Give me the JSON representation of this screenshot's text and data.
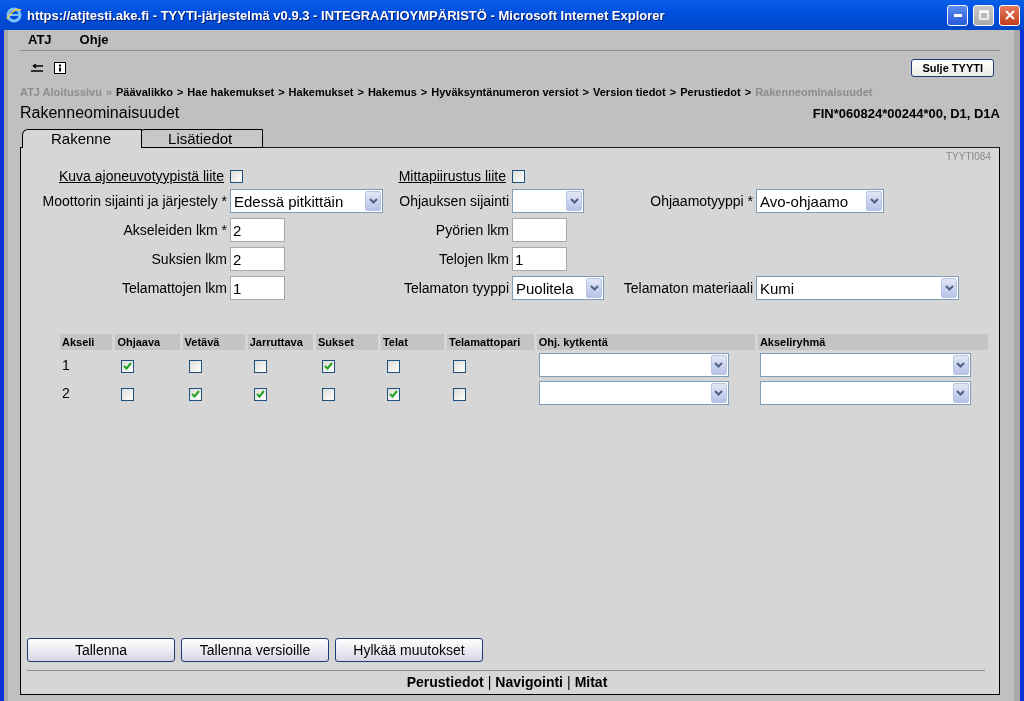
{
  "window": {
    "title": "https://atjtesti.ake.fi - TYYTI-järjestelmä v0.9.3 - INTEGRAATIOYMPÄRISTÖ - Microsoft Internet Explorer"
  },
  "menu": [
    "ATJ",
    "Ohje"
  ],
  "toolbar": {
    "close_button": "Sulje TYYTI"
  },
  "breadcrumb": [
    {
      "kind": "link",
      "label": "ATJ Aloitussivu",
      "disabled": true
    },
    {
      "kind": "separator",
      "label": "»"
    },
    {
      "kind": "link",
      "label": "Päävalikko",
      "disabled": false
    },
    {
      "kind": "separator",
      "label": ">"
    },
    {
      "kind": "link",
      "label": "Hae hakemukset",
      "disabled": false
    },
    {
      "kind": "separator",
      "label": ">"
    },
    {
      "kind": "link",
      "label": "Hakemukset",
      "disabled": false
    },
    {
      "kind": "separator",
      "label": ">"
    },
    {
      "kind": "link",
      "label": "Hakemus",
      "disabled": false
    },
    {
      "kind": "separator",
      "label": ">"
    },
    {
      "kind": "link",
      "label": "Hyväksyntänumeron versiot",
      "disabled": false
    },
    {
      "kind": "separator",
      "label": ">"
    },
    {
      "kind": "link",
      "label": "Version tiedot",
      "disabled": false
    },
    {
      "kind": "separator",
      "label": ">"
    },
    {
      "kind": "link",
      "label": "Perustiedot",
      "disabled": false
    },
    {
      "kind": "separator",
      "label": ">"
    },
    {
      "kind": "link",
      "label": "Rakenneominaisuudet",
      "disabled": true
    }
  ],
  "page_title": "Rakenneominaisuudet",
  "vehicle_id": "FIN*060824*00244*00, D1, D1A",
  "tabs": [
    {
      "label": "Rakenne",
      "selected": true
    },
    {
      "label": "Lisätiedot",
      "selected": false
    }
  ],
  "screen_code": "TYYTI084",
  "form_rows": [
    {
      "fields": [
        {
          "kind": "checkbox",
          "label": "Kuva ajoneuvotyypistä liite",
          "checked": false
        },
        {
          "kind": "checkbox",
          "label": "Mittapiirustus liite",
          "checked": false
        }
      ]
    },
    {
      "fields": [
        {
          "kind": "select",
          "label": "Moottorin sijainti ja järjestely *",
          "value": "Edessä pitkittäin"
        },
        {
          "kind": "select",
          "label": "Ohjauksen sijainti"
        },
        {
          "kind": "select",
          "label": "Ohjaamotyyppi *",
          "value": "Avo-ohjaamo"
        }
      ]
    },
    {
      "fields": [
        {
          "kind": "text",
          "label": "Akseleiden lkm *",
          "value": "2"
        },
        {
          "kind": "text",
          "label": "Pyörien lkm"
        }
      ]
    },
    {
      "fields": [
        {
          "kind": "text",
          "label": "Suksien lkm",
          "value": "2"
        },
        {
          "kind": "text",
          "label": "Telojen lkm",
          "value": "1"
        }
      ]
    },
    {
      "fields": [
        {
          "kind": "text",
          "label": "Telamattojen lkm",
          "value": "1"
        },
        {
          "kind": "select",
          "label": "Telamaton tyyppi",
          "value": "Puolitela"
        },
        {
          "kind": "select",
          "label": "Telamaton materiaali",
          "value": "Kumi"
        }
      ]
    }
  ],
  "axle_table": {
    "columns": [
      "Akseli",
      "Ohjaava",
      "Vetävä",
      "Jarruttava",
      "Sukset",
      "Telat",
      "Telamattopari",
      "Ohj. kytkentä",
      "Akseliryhmä"
    ],
    "rows": [
      {
        "axle": "1",
        "flags": [
          {
            "checked": true
          },
          {
            "checked": false
          },
          {
            "checked": false
          },
          {
            "checked": true
          },
          {
            "checked": false
          },
          {
            "checked": false
          }
        ]
      },
      {
        "axle": "2",
        "flags": [
          {
            "checked": false
          },
          {
            "checked": true
          },
          {
            "checked": true
          },
          {
            "checked": false
          },
          {
            "checked": true
          },
          {
            "checked": false
          }
        ]
      }
    ]
  },
  "buttons": [
    "Tallenna",
    "Tallenna versioille",
    "Hylkää muutokset"
  ],
  "footer": [
    {
      "kind": "link",
      "label": "Perustiedot"
    },
    {
      "kind": "separator",
      "label": "|"
    },
    {
      "kind": "link",
      "label": "Navigointi"
    },
    {
      "kind": "separator",
      "label": "|"
    },
    {
      "kind": "link",
      "label": "Mitat"
    }
  ]
}
